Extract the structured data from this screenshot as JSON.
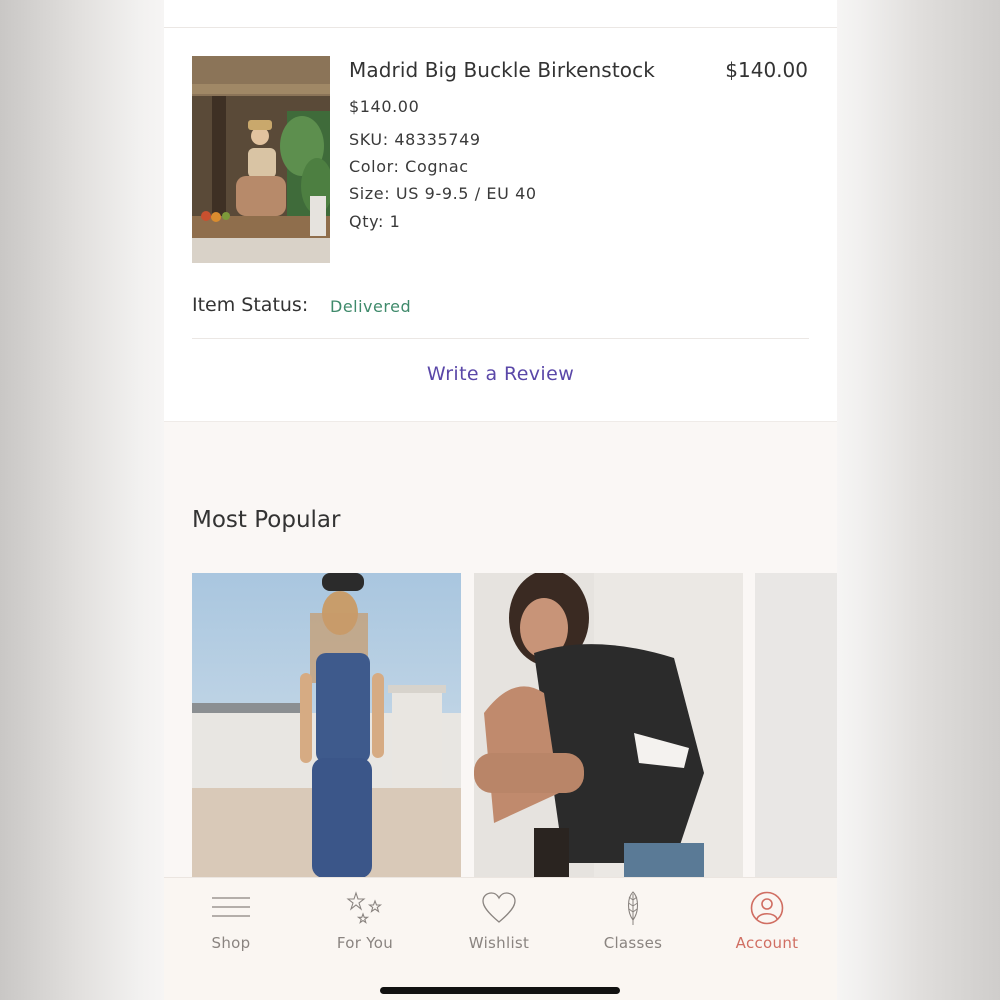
{
  "order_item": {
    "name": "Madrid Big Buckle Birkenstock",
    "total_price": "$140.00",
    "unit_price": "$140.00",
    "sku": "SKU: 48335749",
    "color": "Color: Cognac",
    "size": "Size: US 9-9.5 / EU 40",
    "qty": "Qty: 1",
    "status_label": "Item Status:",
    "status_value": "Delivered",
    "review_link": "Write a Review"
  },
  "most_popular": {
    "title": "Most Popular"
  },
  "tabbar": {
    "tabs": [
      {
        "label": "Shop",
        "icon": "menu-lines-icon"
      },
      {
        "label": "For You",
        "icon": "stars-icon"
      },
      {
        "label": "Wishlist",
        "icon": "heart-icon"
      },
      {
        "label": "Classes",
        "icon": "feather-icon"
      },
      {
        "label": "Account",
        "icon": "account-icon"
      }
    ],
    "active": "Account"
  },
  "colors": {
    "status_green": "#3f8a6b",
    "link_purple": "#5a47a8",
    "active_tab": "#d06e62"
  }
}
